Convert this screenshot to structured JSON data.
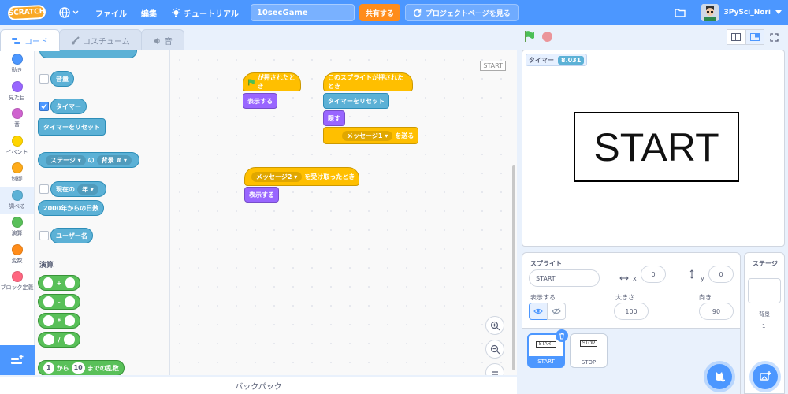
{
  "menubar": {
    "logo": "SCRATCH",
    "file": "ファイル",
    "edit": "編集",
    "tutorials": "チュートリアル",
    "project_title": "10secGame",
    "share": "共有する",
    "see_project": "プロジェクトページを見る",
    "username": "3PySci_Nori"
  },
  "tabs": {
    "code": "コード",
    "costumes": "コスチューム",
    "sounds": "音"
  },
  "categories": [
    {
      "label": "動き",
      "color": "#4c97ff"
    },
    {
      "label": "見た目",
      "color": "#9966ff"
    },
    {
      "label": "音",
      "color": "#cf63cf"
    },
    {
      "label": "イベント",
      "color": "#ffd500"
    },
    {
      "label": "制御",
      "color": "#ffab19"
    },
    {
      "label": "調べる",
      "color": "#5cb1d6"
    },
    {
      "label": "演算",
      "color": "#59c059"
    },
    {
      "label": "変数",
      "color": "#ff8c1a"
    },
    {
      "label": "ブロック定義",
      "color": "#ff6680"
    }
  ],
  "palette": {
    "loudness": "音量",
    "timer": "タイマー",
    "reset_timer": "タイマーをリセット",
    "stage": "ステージ",
    "of": "の",
    "backdrop_no": "背景 #",
    "current": "現在の",
    "year": "年",
    "days_since": "2000年からの日数",
    "username": "ユーザー名",
    "operators_title": "演算",
    "plus": "+",
    "minus": "-",
    "times": "*",
    "divide": "/",
    "rand_from": "1",
    "rand_kara": "から",
    "rand_to": "10",
    "rand_label": "までの乱数"
  },
  "scripts": {
    "sprite_label": "START",
    "flag_clicked": "が押されたとき",
    "show": "表示する",
    "sprite_clicked": "このスプライトが押されたとき",
    "reset_timer": "タイマーをリセット",
    "hide": "隠す",
    "message1": "メッセージ1",
    "send": "を送る",
    "message2": "メッセージ2",
    "received": "を受け取ったとき",
    "show2": "表示する"
  },
  "backpack": "バックパック",
  "stage": {
    "monitor_label": "タイマー",
    "monitor_value": "8.031",
    "sprite_text": "START"
  },
  "sprite_info": {
    "sprite": "スプライト",
    "name": "START",
    "x_label": "x",
    "x_value": "0",
    "y_label": "y",
    "y_value": "0",
    "show": "表示する",
    "size": "大きさ",
    "size_value": "100",
    "direction": "向き",
    "direction_value": "90"
  },
  "sprites": [
    {
      "name": "START",
      "thumb": "START"
    },
    {
      "name": "STOP",
      "thumb": "STOP"
    }
  ],
  "stage_pane": {
    "title": "ステージ",
    "backdrops_label": "背景",
    "backdrops_count": "1"
  }
}
